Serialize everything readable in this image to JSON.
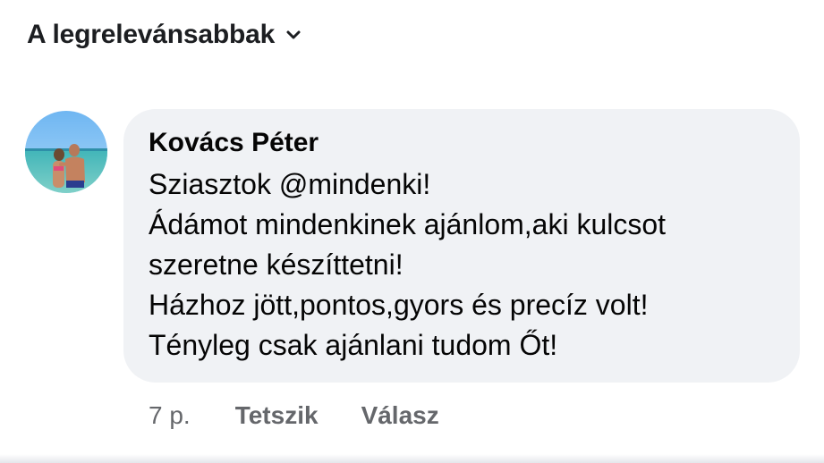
{
  "sort": {
    "label": "A legrelevánsabbak",
    "icon": "chevron-down-icon"
  },
  "comment": {
    "author": "Kovács Péter",
    "avatar_icon": "profile-photo",
    "lines": [
      "Sziasztok @mindenki!",
      "Ádámot mindenkinek ajánlom,aki kulcsot",
      "szeretne készíttetni!",
      "Házhoz jött,pontos,gyors és precíz volt!",
      "Tényleg csak ajánlani tudom Őt!"
    ],
    "timestamp": "7 p.",
    "like_label": "Tetszik",
    "reply_label": "Válasz"
  },
  "colors": {
    "bubble_bg": "#f0f2f5",
    "secondary_text": "#65676b",
    "primary_text": "#050505"
  }
}
